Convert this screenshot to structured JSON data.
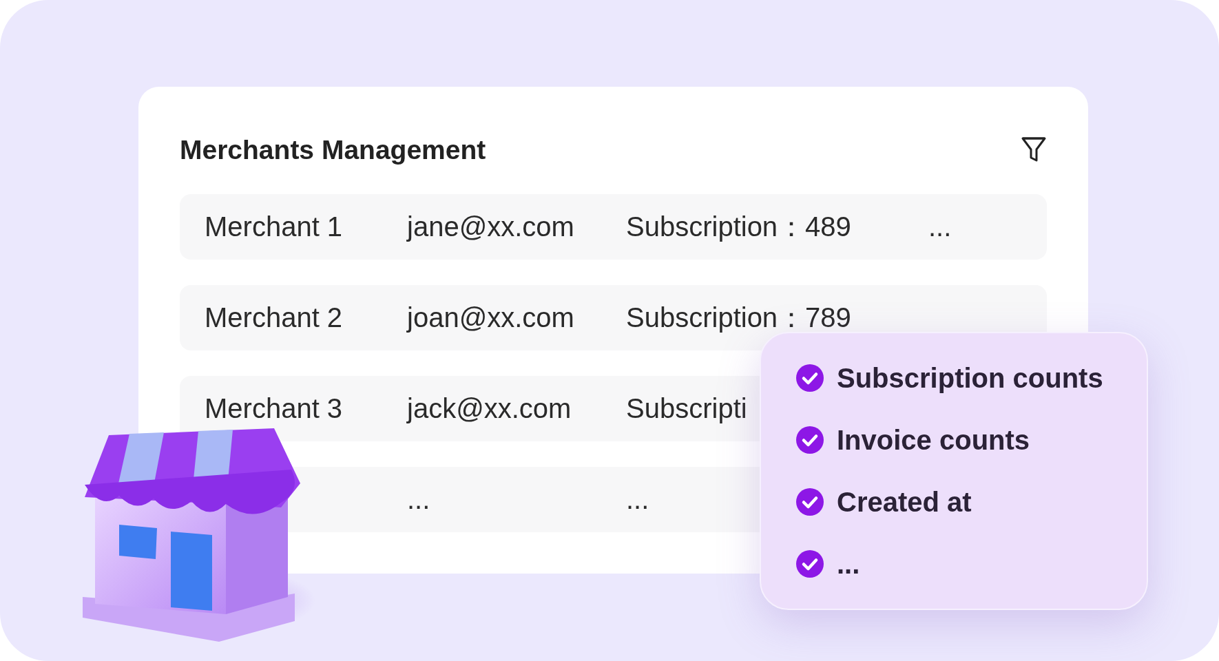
{
  "card": {
    "title": "Merchants Management",
    "rows": [
      {
        "name": "Merchant 1",
        "email": "jane@xx.com",
        "subscription": "Subscription：489",
        "more": "..."
      },
      {
        "name": "Merchant 2",
        "email": "joan@xx.com",
        "subscription": "Subscription：789"
      },
      {
        "name": "Merchant 3",
        "email": "jack@xx.com",
        "subscription": "Subscripti"
      },
      {
        "email": "...",
        "subscription": "..."
      }
    ]
  },
  "popup": {
    "items": [
      {
        "label": "Subscription counts",
        "checked": true
      },
      {
        "label": "Invoice counts",
        "checked": true
      },
      {
        "label": "Created at",
        "checked": true
      },
      {
        "label": "...",
        "checked": true
      }
    ]
  }
}
